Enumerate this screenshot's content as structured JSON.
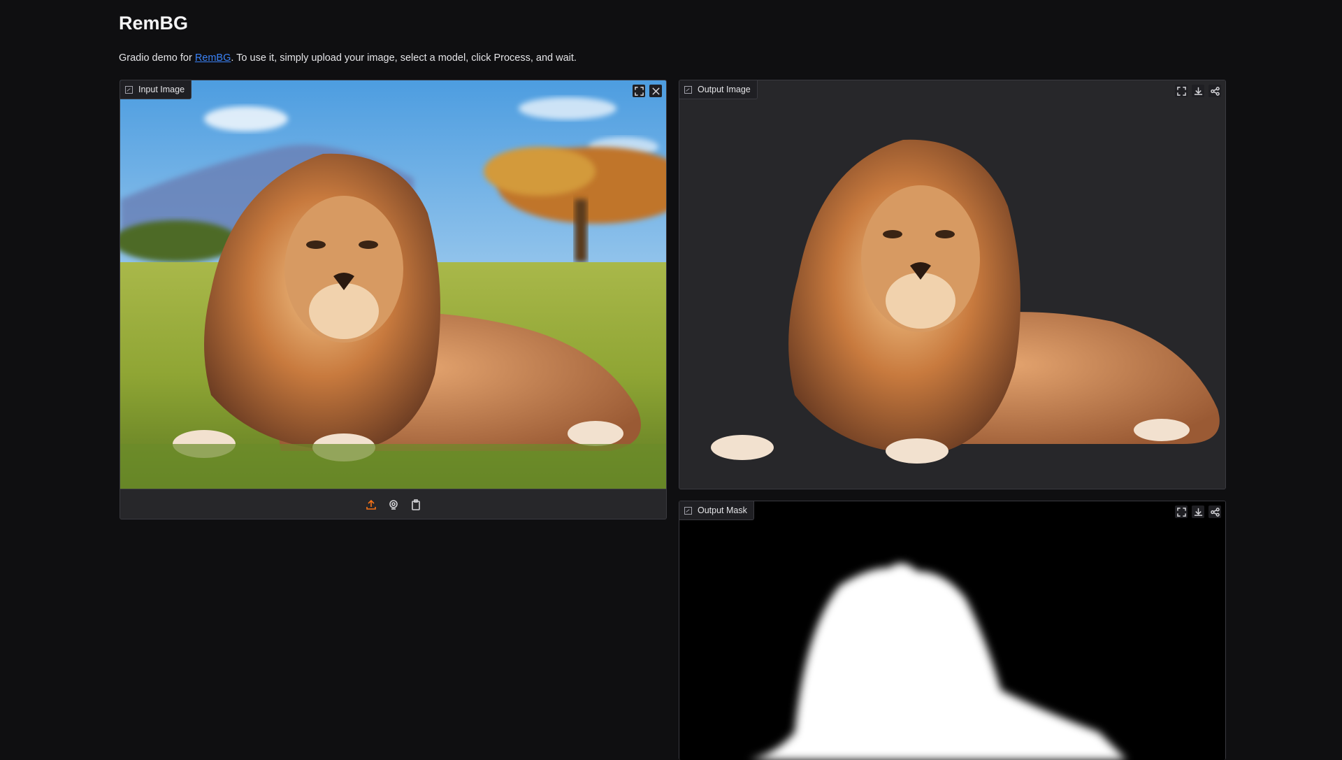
{
  "header": {
    "title": "RemBG",
    "desc_before": "Gradio demo for ",
    "desc_link": "RemBG",
    "desc_after": ". To use it, simply upload your image, select a model, click Process, and wait."
  },
  "input_image": {
    "label": "Input Image",
    "toolbar_icons": [
      "fullscreen-icon",
      "close-icon"
    ],
    "source_icons": [
      "upload-icon",
      "webcam-icon",
      "clipboard-icon"
    ]
  },
  "output_image": {
    "label": "Output Image",
    "toolbar_icons": [
      "fullscreen-icon",
      "download-icon",
      "share-icon"
    ]
  },
  "output_mask": {
    "label": "Output Mask",
    "toolbar_icons": [
      "fullscreen-icon",
      "download-icon",
      "share-icon"
    ]
  },
  "colors": {
    "background": "#0f0f11",
    "panel": "#27272a",
    "link": "#3b82f6",
    "upload_accent": "#f97316"
  }
}
